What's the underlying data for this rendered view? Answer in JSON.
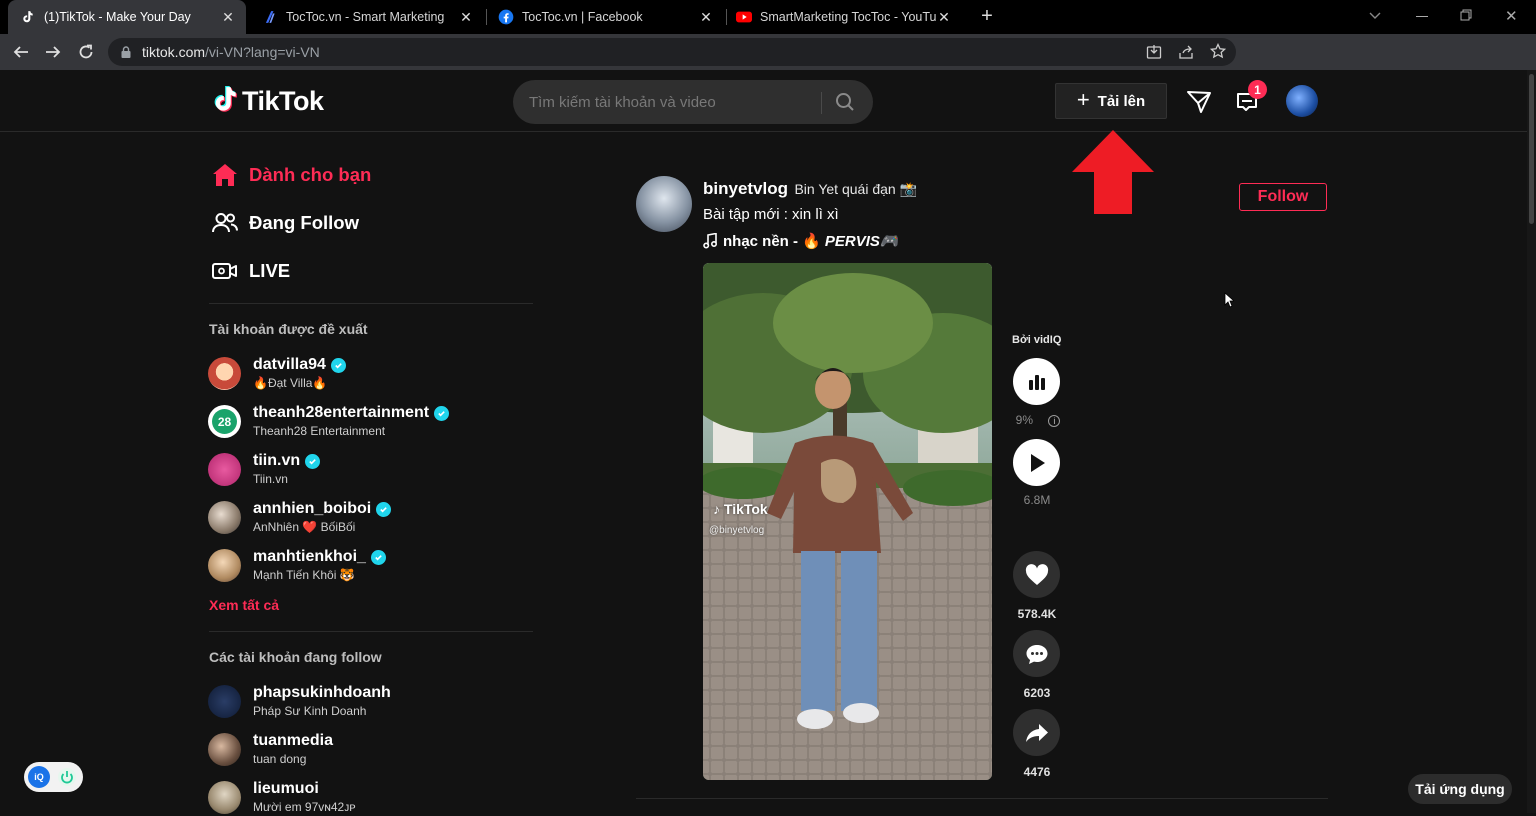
{
  "browser": {
    "tabs": [
      {
        "title": "(1)TikTok - Make Your Day",
        "icon": "tiktok-favicon",
        "active": true
      },
      {
        "title": "TocToc.vn - Smart Marketing",
        "icon": "toctoc-favicon",
        "active": false
      },
      {
        "title": "TocToc.vn | Facebook",
        "icon": "facebook-favicon",
        "active": false
      },
      {
        "title": "SmartMarketing TocToc - YouTube",
        "icon": "youtube-favicon",
        "active": false
      }
    ],
    "url_host": "tiktok.com",
    "url_path": "/vi-VN?lang=vi-VN"
  },
  "header": {
    "logo": "TikTok",
    "search_placeholder": "Tìm kiếm tài khoản và video",
    "upload_label": "Tải lên",
    "inbox_badge": "1"
  },
  "sidebar": {
    "nav": [
      {
        "label": "Dành cho bạn",
        "icon": "home-icon",
        "active": true
      },
      {
        "label": "Đang Follow",
        "icon": "following-icon",
        "active": false
      },
      {
        "label": "LIVE",
        "icon": "live-icon",
        "active": false
      }
    ],
    "suggested_title": "Tài khoản được đề xuất",
    "suggested": [
      {
        "username": "datvilla94",
        "display": "🔥Đạt Villa🔥",
        "verified": true,
        "color": "#c84a3a"
      },
      {
        "username": "theanh28entertainment",
        "display": "Theanh28 Entertainment",
        "verified": true,
        "color": "#1aa36b"
      },
      {
        "username": "tiin.vn",
        "display": "Tiin.vn",
        "verified": true,
        "color": "#d63a7e"
      },
      {
        "username": "annhien_boiboi",
        "display": "AnNhiên ❤️ BốiBối",
        "verified": true,
        "color": "#8a7a6a"
      },
      {
        "username": "manhtienkhoi_",
        "display": "Mạnh Tiến Khôi 🐯",
        "verified": true,
        "color": "#b08a60"
      }
    ],
    "see_all": "Xem tất cả",
    "following_title": "Các tài khoản đang follow",
    "following": [
      {
        "username": "phapsukinhdoanh",
        "display": "Pháp Sư Kinh Doanh",
        "color": "#1b2a4a"
      },
      {
        "username": "tuanmedia",
        "display": "tuan dong",
        "color": "#6a5040"
      },
      {
        "username": "lieumuoi",
        "display": "Mười em 97ᴠɴ42ᴊᴘ",
        "color": "#9a8a70"
      }
    ]
  },
  "post": {
    "username": "binyetvlog",
    "display_name": "Bin Yet quái đạn 📸",
    "caption": "Bài tập mới : xin lì xì",
    "music": "nhạc nền - 🔥",
    "music_artist": "PERVIS🎮",
    "follow_label": "Follow",
    "watermark": "TikTok",
    "watermark_handle": "@binyetvlog",
    "vidiq_label": "Bởi vidIQ",
    "vidiq_percent": "9%",
    "views": "6.8M",
    "likes": "578.4K",
    "comments": "6203",
    "shares": "4476"
  },
  "get_app": "Tải ứng dụng"
}
